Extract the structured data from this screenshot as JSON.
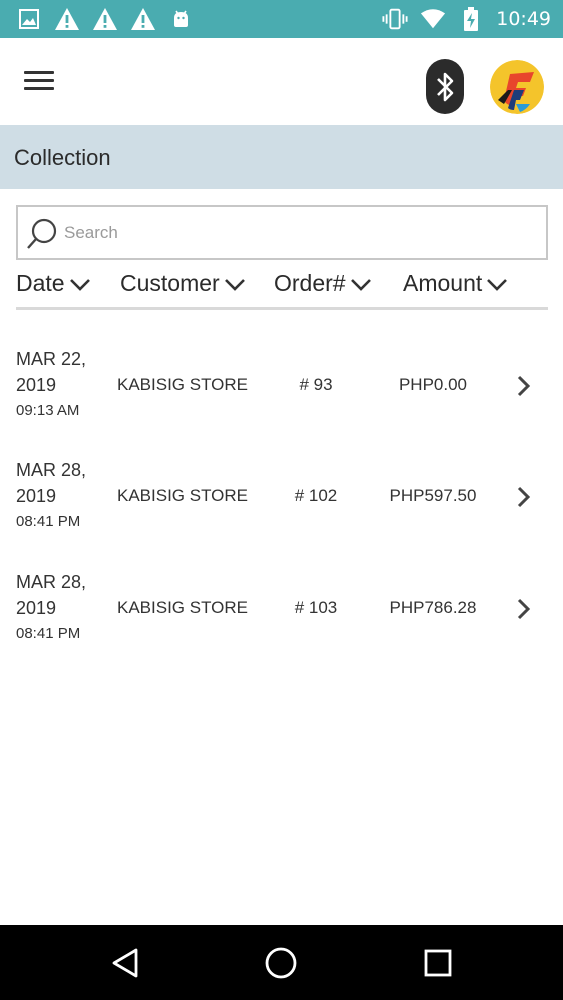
{
  "status_bar": {
    "time": "10:49",
    "left_icons": [
      "image-icon",
      "warning-icon",
      "warning-icon",
      "warning-icon",
      "android-icon"
    ],
    "right_icons": [
      "vibrate-icon",
      "wifi-icon",
      "battery-charging-icon"
    ]
  },
  "app_bar": {
    "menu_icon": "menu-icon",
    "bluetooth_icon": "bluetooth-icon",
    "logo_icon": "app-logo"
  },
  "section": {
    "title": "Collection"
  },
  "search": {
    "placeholder": "Search",
    "value": ""
  },
  "columns": [
    {
      "label": "Date"
    },
    {
      "label": "Customer"
    },
    {
      "label": "Order#"
    },
    {
      "label": "Amount"
    }
  ],
  "rows": [
    {
      "date": "MAR 22,",
      "year": "2019",
      "time": "09:13 AM",
      "customer": "KABISIG STORE",
      "order": "# 93",
      "amount": "PHP0.00"
    },
    {
      "date": "MAR 28,",
      "year": "2019",
      "time": "08:41 PM",
      "customer": "KABISIG STORE",
      "order": "# 102",
      "amount": "PHP597.50"
    },
    {
      "date": "MAR 28,",
      "year": "2019",
      "time": "08:41 PM",
      "customer": "KABISIG STORE",
      "order": "# 103",
      "amount": "PHP786.28"
    }
  ],
  "colors": {
    "status_bar": "#4aacb0",
    "section_bg": "#cfdde5",
    "nav_bar": "#000000"
  },
  "nav": {
    "icons": [
      "back-icon",
      "home-icon",
      "recents-icon"
    ]
  }
}
